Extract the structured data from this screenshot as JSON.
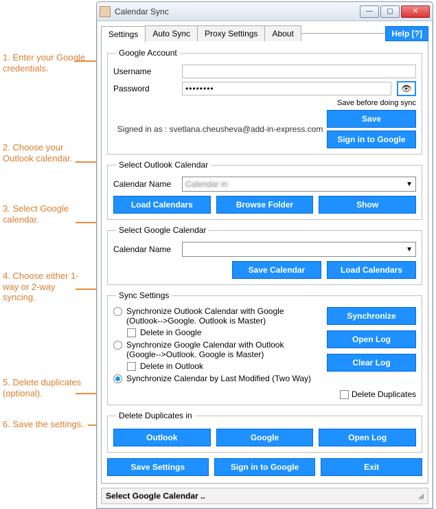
{
  "annotations": {
    "a1": "1. Enter your Google credentials.",
    "a2": "2. Choose your Outlook calendar.",
    "a3": "3. Select Google calendar.",
    "a4": "4. Choose either 1-way or 2-way syncing.",
    "a5": "5. Delete duplicates (optional).",
    "a6": "6. Save the settings."
  },
  "window": {
    "title": "Calendar Sync",
    "tabs": [
      "Settings",
      "Auto Sync",
      "Proxy Settings",
      "About"
    ],
    "help": "Help [?]"
  },
  "google_account": {
    "legend": "Google Account",
    "username_label": "Username",
    "username_value": "",
    "password_label": "Password",
    "password_value": "••••••••",
    "save_note": "Save before doing sync",
    "signed_in": "Signed in as : svetlana.cheusheva@add-in-express.com",
    "save_btn": "Save",
    "signin_btn": "Sign in to Google"
  },
  "outlook": {
    "legend": "Select Outlook Calendar",
    "name_label": "Calendar Name",
    "name_value": "Calendar in",
    "load_btn": "Load Calendars",
    "browse_btn": "Browse Folder",
    "show_btn": "Show"
  },
  "gcal": {
    "legend": "Select Google Calendar",
    "name_label": "Calendar Name",
    "name_value": "",
    "save_btn": "Save Calendar",
    "load_btn": "Load Calendars"
  },
  "sync": {
    "legend": "Sync Settings",
    "r1a": "Synchronize Outlook Calendar with Google",
    "r1b": "(Outlook-->Google. Outlook is Master)",
    "d1": "Delete in Google",
    "r2a": "Synchronize Google Calendar with Outlook",
    "r2b": "(Google-->Outlook. Google is Master)",
    "d2": "Delete in Outlook",
    "r3": "Synchronize Calendar by Last Modified (Two Way)",
    "sync_btn": "Synchronize",
    "open_log": "Open Log",
    "clear_log": "Clear Log",
    "del_dup": "Delete Duplicates"
  },
  "dup": {
    "legend": "Delete Duplicates in",
    "outlook": "Outlook",
    "google": "Google",
    "open_log": "Open Log"
  },
  "bottom": {
    "save": "Save Settings",
    "signin": "Sign in to Google",
    "exit": "Exit"
  },
  "status": "Select Google Calendar .."
}
